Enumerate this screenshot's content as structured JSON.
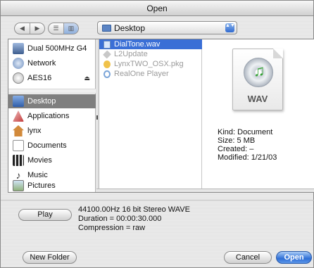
{
  "window": {
    "title": "Open"
  },
  "toolbar": {
    "back_glyph": "◀",
    "forward_glyph": "▶",
    "list_glyph": "☰",
    "column_glyph": "▥",
    "location": "Desktop",
    "popup_glyph": "▲▼"
  },
  "sidebar": {
    "devices": [
      {
        "label": "Dual 500MHz G4",
        "icon": "computer-icon"
      },
      {
        "label": "Network",
        "icon": "network-icon"
      },
      {
        "label": "AES16",
        "icon": "disk-icon",
        "eject": "⏏"
      }
    ],
    "places": [
      {
        "label": "Desktop",
        "icon": "desktop-icon",
        "selected": true
      },
      {
        "label": "Applications",
        "icon": "applications-icon"
      },
      {
        "label": "lynx",
        "icon": "home-icon"
      },
      {
        "label": "Documents",
        "icon": "documents-icon"
      },
      {
        "label": "Movies",
        "icon": "movies-icon"
      },
      {
        "label": "Music",
        "icon": "music-icon"
      },
      {
        "label": "Pictures",
        "icon": "pictures-icon"
      }
    ]
  },
  "files": [
    {
      "name": "DialTone.wav",
      "selected": true,
      "icon": "wav-file-icon"
    },
    {
      "name": "L2Update",
      "icon": "application-icon"
    },
    {
      "name": "LynxTWO_OSX.pkg",
      "icon": "package-icon"
    },
    {
      "name": "RealOne Player",
      "icon": "realone-icon"
    }
  ],
  "preview": {
    "badge": "WAV",
    "note_glyph": "♫",
    "kind": "Kind: Document",
    "size": "Size: 5 MB",
    "created": "Created: –",
    "modified": "Modified: 1/21/03"
  },
  "playback": {
    "play_label": "Play",
    "format": "44100.00Hz 16 bit Stereo WAVE",
    "duration": "Duration = 00:00:30.000",
    "compression": "Compression = raw"
  },
  "footer": {
    "new_folder": "New Folder",
    "cancel": "Cancel",
    "open": "Open"
  },
  "colors": {
    "selection": "#3a6fd6",
    "sidebar_selection": "#7f7f7f",
    "default_button": "#2f6fd6"
  }
}
